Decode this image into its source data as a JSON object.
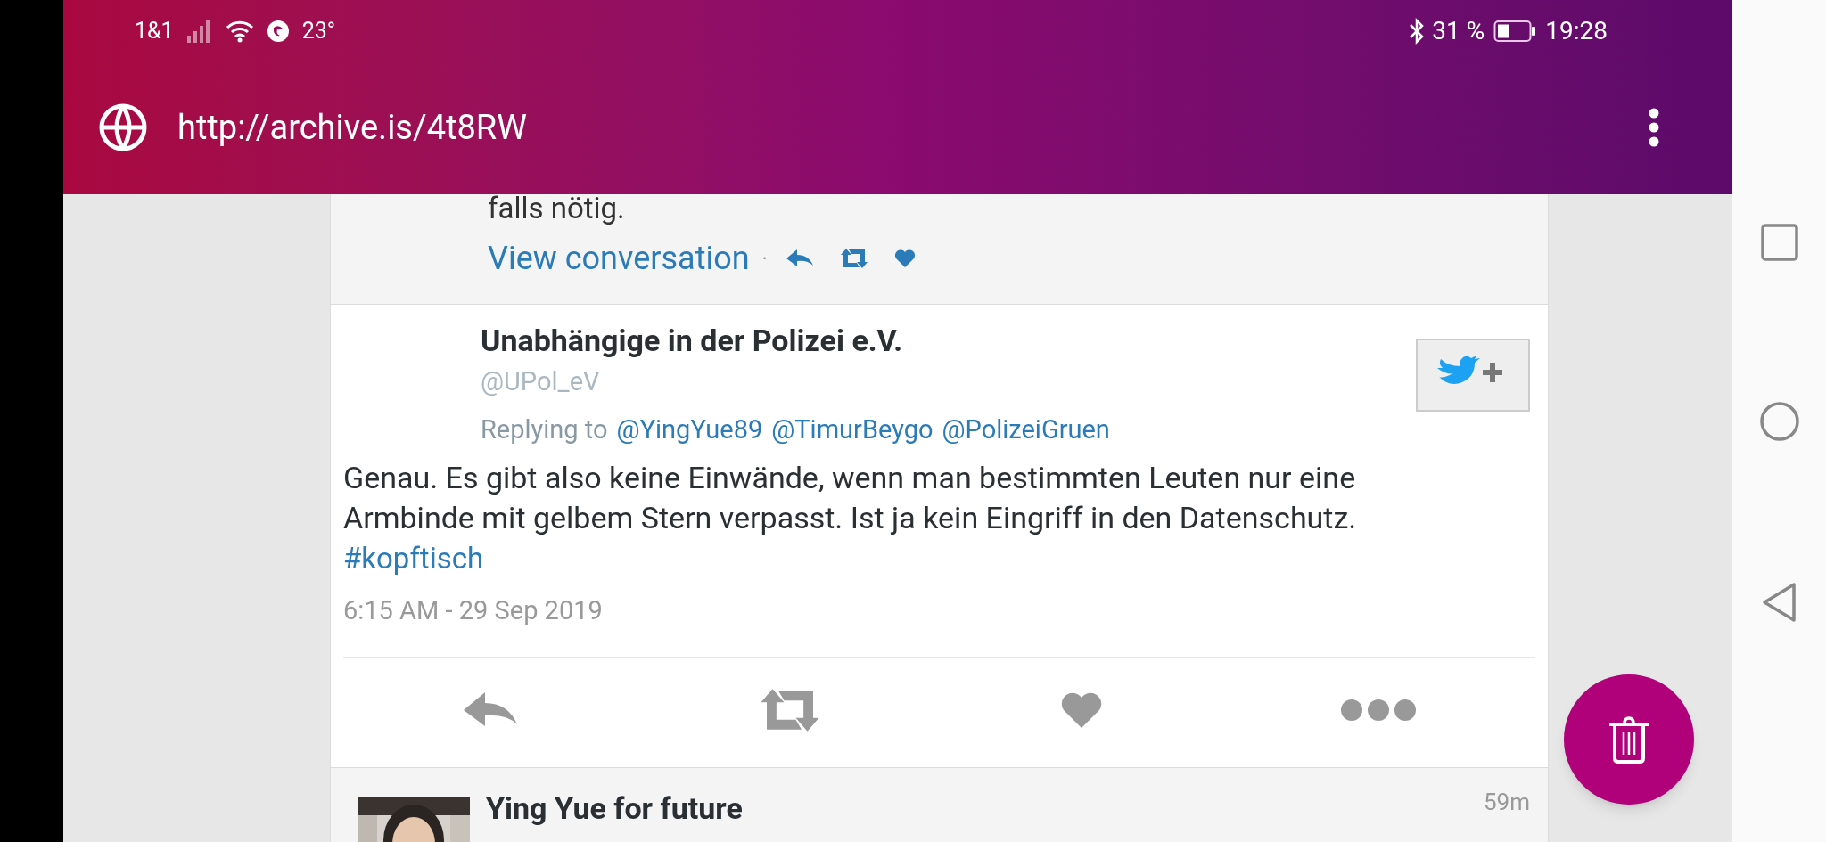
{
  "status_bar": {
    "carrier": "1&1",
    "temperature": "23°",
    "battery": "31 %",
    "time": "19:28"
  },
  "address_bar": {
    "url": "http://archive.is/4t8RW"
  },
  "previous_tweet": {
    "text": "falls nötig.",
    "link": "View conversation",
    "separator": "·"
  },
  "tweet": {
    "name": "Unabhängige in der Polizei e.V.",
    "handle": "@UPol_eV",
    "replying_label": "Replying to",
    "mentions": [
      "@YingYue89",
      "@TimurBeygo",
      "@PolizeiGruen"
    ],
    "text": "Genau. Es gibt also keine Einwände, wenn man bestimmten Leuten nur eine Armbinde mit gelbem Stern verpasst. Ist ja kein Eingriff in den Datenschutz.",
    "hashtag": "#kopftisch",
    "timestamp": "6:15 AM - 29 Sep 2019"
  },
  "next_tweet": {
    "name": "Ying Yue for future",
    "age": "59m"
  }
}
